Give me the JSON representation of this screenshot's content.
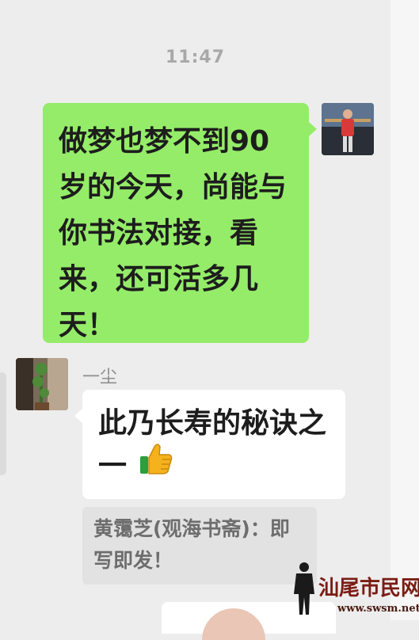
{
  "chat": {
    "timestamp": "11:47",
    "outgoing": {
      "text": "做梦也梦不到90岁的今天，尚能与你书法对接，看来，还可活多几天！",
      "bubble_color": "#95ec69"
    },
    "incoming": {
      "sender": "一尘",
      "text": "此乃长寿的秘诀之一",
      "emoji_icon": "thumbs-up-icon",
      "quote": "黄霭芝(观海书斋)：即写即发！"
    }
  },
  "watermark": {
    "title": "汕尾市民网",
    "url": "www.swsm.net"
  },
  "colors": {
    "background": "#ededed",
    "incoming_bubble": "#ffffff",
    "quote_bg": "#e2e2e2",
    "watermark": "#7a1c14"
  }
}
